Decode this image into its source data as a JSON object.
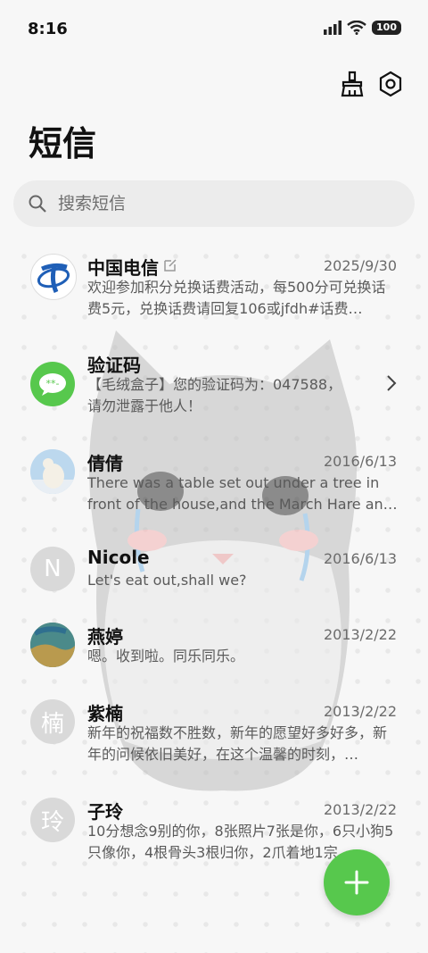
{
  "status_bar": {
    "time": "8:16",
    "battery": "100"
  },
  "page_title": "短信",
  "search": {
    "placeholder": "搜索短信"
  },
  "messages": [
    {
      "sender": "中国电信",
      "date": "2025/9/30",
      "preview": "欢迎参加积分兑换话费活动，每500分可兑换话费5元，兑换话费请回复106或jfdh#话费…"
    },
    {
      "sender": "验证码",
      "date": "",
      "preview": "【毛绒盒子】您的验证码为：047588，请勿泄露于他人！"
    },
    {
      "sender": "倩倩",
      "date": "2016/6/13",
      "preview": "There was a table set out under a tree in front of the house,and the March Hare an…"
    },
    {
      "sender": "Nicole",
      "date": "2016/6/13",
      "preview": "Let's eat out,shall we?",
      "avatar_letter": "N"
    },
    {
      "sender": "燕婷",
      "date": "2013/2/22",
      "preview": "嗯。收到啦。同乐同乐。"
    },
    {
      "sender": "紫楠",
      "date": "2013/2/22",
      "preview": "新年的祝福数不胜数，新年的愿望好多好多，新年的问候依旧美好，在这个温馨的时刻，…",
      "avatar_letter": "楠"
    },
    {
      "sender": "子玲",
      "date": "2013/2/22",
      "preview": "10分想念9别的你，8张照片7张是你，6只小狗5只像你，4根骨头3根归你，2爪着地1宗…",
      "avatar_letter": "玲"
    }
  ],
  "colors": {
    "accent_green": "#57c84d",
    "telecom_blue": "#1f5fb7"
  }
}
